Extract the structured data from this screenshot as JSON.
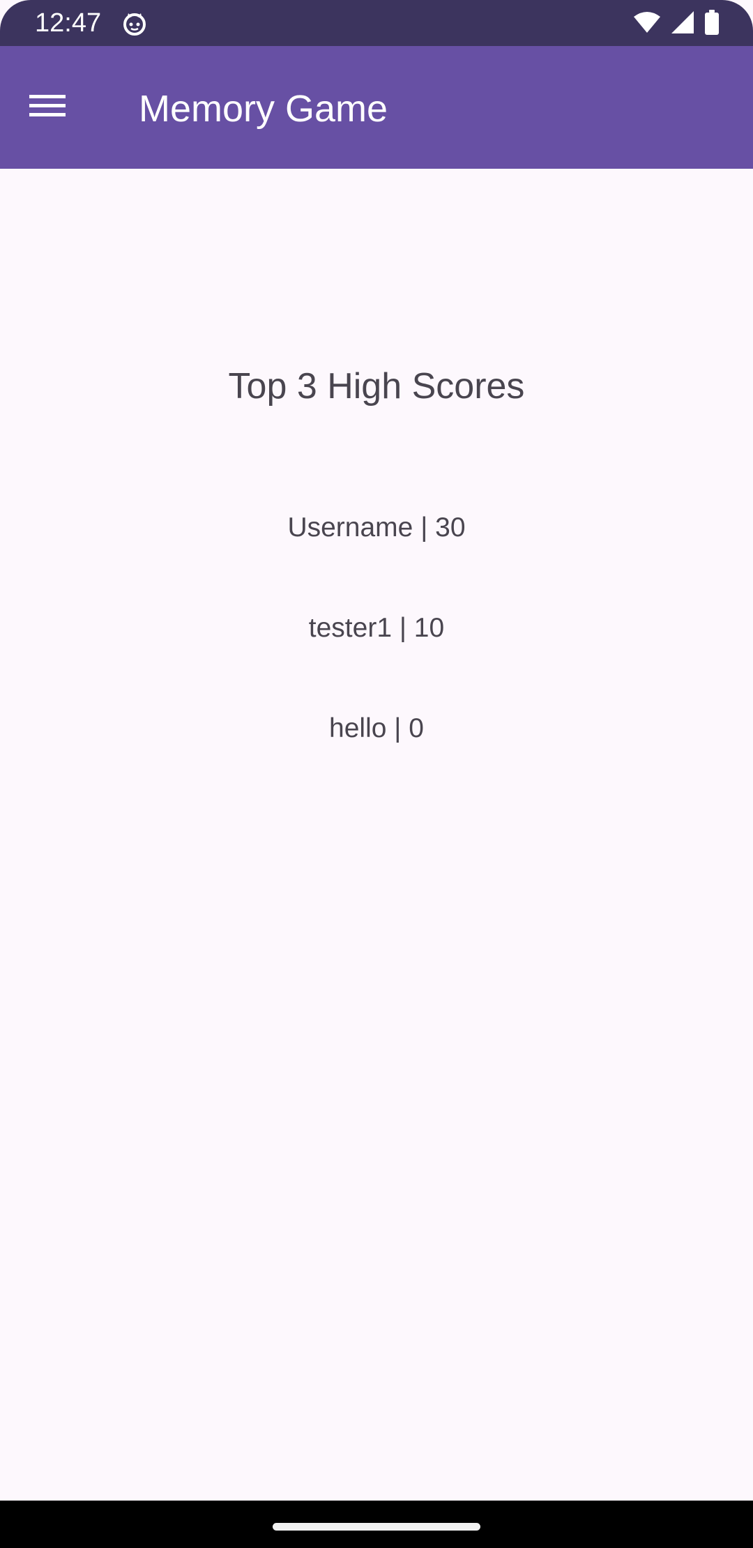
{
  "status_bar": {
    "time": "12:47",
    "app_icon": "android-cat-icon",
    "wifi_icon": "wifi-icon",
    "signal_icon": "cellular-signal-icon",
    "battery_icon": "battery-icon",
    "background_color": "#3c345e"
  },
  "app_bar": {
    "title": "Memory Game",
    "menu_icon": "hamburger-menu-icon",
    "background_color": "#6750a4"
  },
  "main": {
    "heading": "Top 3 High Scores",
    "scores": [
      "Username | 30",
      "tester1 | 10",
      "hello | 0"
    ],
    "background_color": "#fdf8fd",
    "text_color": "#49454f"
  },
  "navigation_bar": {
    "home_indicator": "home-gesture-handle"
  }
}
